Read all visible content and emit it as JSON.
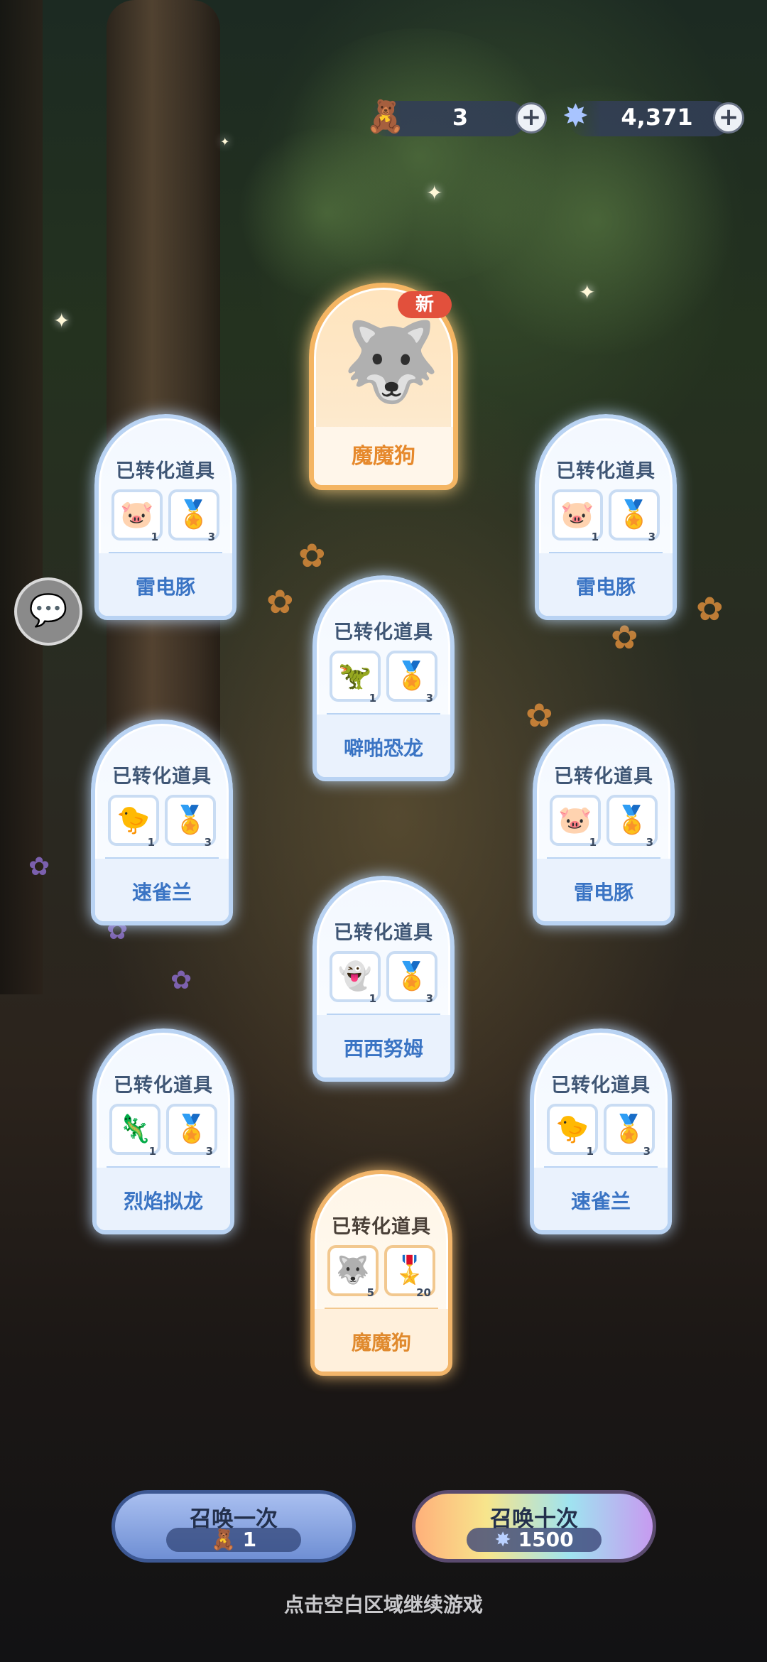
{
  "resources": {
    "ticket": {
      "icon": "bear-ticket-icon",
      "value": "3"
    },
    "star": {
      "icon": "star-crystal-icon",
      "value": "4,371"
    }
  },
  "hero_card": {
    "badge": "新",
    "name": "魔魔狗",
    "pet_icon": "demon-dog-icon"
  },
  "cards": [
    {
      "title": "已转化道具",
      "name": "雷电豚",
      "item_a": {
        "icon": "thunder-pig-icon",
        "count": "1"
      },
      "item_b": {
        "icon": "gold-medal-icon",
        "count": "3"
      }
    },
    {
      "title": "已转化道具",
      "name": "雷电豚",
      "item_a": {
        "icon": "thunder-pig-icon",
        "count": "1"
      },
      "item_b": {
        "icon": "gold-medal-icon",
        "count": "3"
      }
    },
    {
      "title": "已转化道具",
      "name": "噼啪恐龙",
      "item_a": {
        "icon": "crackle-dino-icon",
        "count": "1"
      },
      "item_b": {
        "icon": "gold-medal-icon",
        "count": "3"
      }
    },
    {
      "title": "已转化道具",
      "name": "速雀兰",
      "item_a": {
        "icon": "swift-bird-icon",
        "count": "1"
      },
      "item_b": {
        "icon": "gold-medal-icon",
        "count": "3"
      }
    },
    {
      "title": "已转化道具",
      "name": "雷电豚",
      "item_a": {
        "icon": "thunder-pig-icon",
        "count": "1"
      },
      "item_b": {
        "icon": "gold-medal-icon",
        "count": "3"
      }
    },
    {
      "title": "已转化道具",
      "name": "西西努姆",
      "item_a": {
        "icon": "white-sprite-icon",
        "count": "1"
      },
      "item_b": {
        "icon": "gold-medal-icon",
        "count": "3"
      }
    },
    {
      "title": "已转化道具",
      "name": "烈焰拟龙",
      "item_a": {
        "icon": "flame-dragon-icon",
        "count": "1"
      },
      "item_b": {
        "icon": "gold-medal-icon",
        "count": "3"
      }
    },
    {
      "title": "已转化道具",
      "name": "速雀兰",
      "item_a": {
        "icon": "swift-bird-icon",
        "count": "1"
      },
      "item_b": {
        "icon": "gold-medal-icon",
        "count": "3"
      }
    },
    {
      "title": "已转化道具",
      "name": "魔魔狗",
      "item_a": {
        "icon": "demon-dog-icon",
        "count": "5"
      },
      "item_b": {
        "icon": "orange-medal-icon",
        "count": "20"
      },
      "rarity": "gold"
    }
  ],
  "buttons": {
    "summon_one": {
      "label": "召唤一次",
      "cost": "1",
      "cost_icon": "bear-ticket-icon"
    },
    "summon_ten": {
      "label": "召唤十次",
      "cost": "1500",
      "cost_icon": "star-crystal-icon"
    }
  },
  "hint": "点击空白区域继续游戏",
  "colors": {
    "card_border": "#b9d3f3",
    "gold_border": "#f2b56a",
    "name_blue": "#3a74c4",
    "name_orange": "#e08a2e",
    "new_badge": "#e2503c"
  }
}
